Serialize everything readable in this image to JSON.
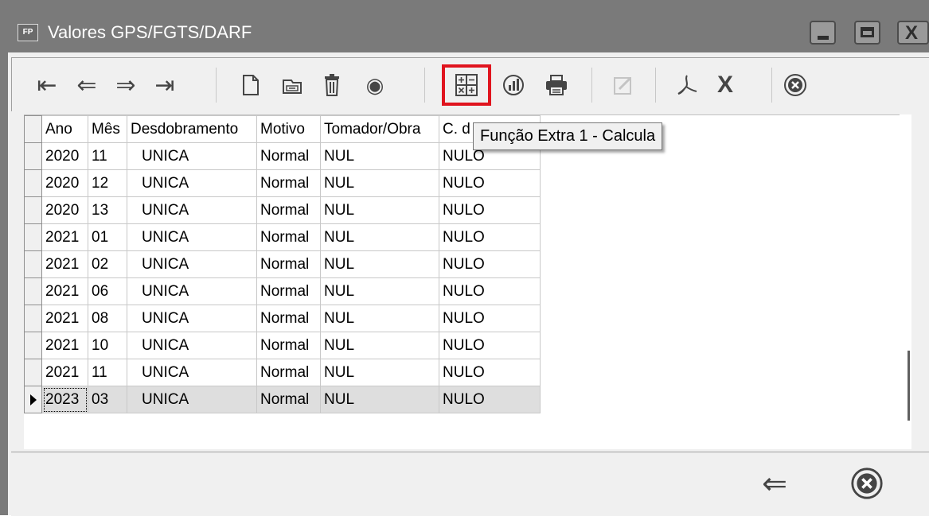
{
  "window": {
    "app_badge": "FP",
    "title": "Valores GPS/FGTS/DARF",
    "close_glyph": "X"
  },
  "toolbar": {
    "first_glyph": "⇤",
    "prev_glyph": "⇐",
    "next_glyph": "⇒",
    "last_glyph": "⇥",
    "view_glyph": "◉",
    "chart_glyph": "⓪",
    "excel_glyph": "X",
    "close_glyph": "⊗"
  },
  "grid": {
    "columns": [
      "Ano",
      "Mês",
      "Desdobramento",
      "Motivo",
      "Tomador/Obra",
      "C. d"
    ],
    "rows": [
      {
        "ano": "2020",
        "mes": "11",
        "desdobramento": "UNICA",
        "motivo": "Normal",
        "tomador": "NUL",
        "cd": "NULO"
      },
      {
        "ano": "2020",
        "mes": "12",
        "desdobramento": "UNICA",
        "motivo": "Normal",
        "tomador": "NUL",
        "cd": "NULO"
      },
      {
        "ano": "2020",
        "mes": "13",
        "desdobramento": "UNICA",
        "motivo": "Normal",
        "tomador": "NUL",
        "cd": "NULO"
      },
      {
        "ano": "2021",
        "mes": "01",
        "desdobramento": "UNICA",
        "motivo": "Normal",
        "tomador": "NUL",
        "cd": "NULO"
      },
      {
        "ano": "2021",
        "mes": "02",
        "desdobramento": "UNICA",
        "motivo": "Normal",
        "tomador": "NUL",
        "cd": "NULO"
      },
      {
        "ano": "2021",
        "mes": "06",
        "desdobramento": "UNICA",
        "motivo": "Normal",
        "tomador": "NUL",
        "cd": "NULO"
      },
      {
        "ano": "2021",
        "mes": "08",
        "desdobramento": "UNICA",
        "motivo": "Normal",
        "tomador": "NUL",
        "cd": "NULO"
      },
      {
        "ano": "2021",
        "mes": "10",
        "desdobramento": "UNICA",
        "motivo": "Normal",
        "tomador": "NUL",
        "cd": "NULO"
      },
      {
        "ano": "2021",
        "mes": "11",
        "desdobramento": "UNICA",
        "motivo": "Normal",
        "tomador": "NUL",
        "cd": "NULO"
      },
      {
        "ano": "2023",
        "mes": "03",
        "desdobramento": "UNICA",
        "motivo": "Normal",
        "tomador": "NUL",
        "cd": "NULO"
      }
    ],
    "selected_row": 9
  },
  "tooltip": {
    "text": "Função Extra 1 - Calcula"
  },
  "footer": {
    "back_glyph": "⇐",
    "close_glyph": "⊗"
  },
  "colors": {
    "title_bar": "#7a7a7a",
    "highlight": "#e0141e",
    "selected_row": "#dedede"
  }
}
